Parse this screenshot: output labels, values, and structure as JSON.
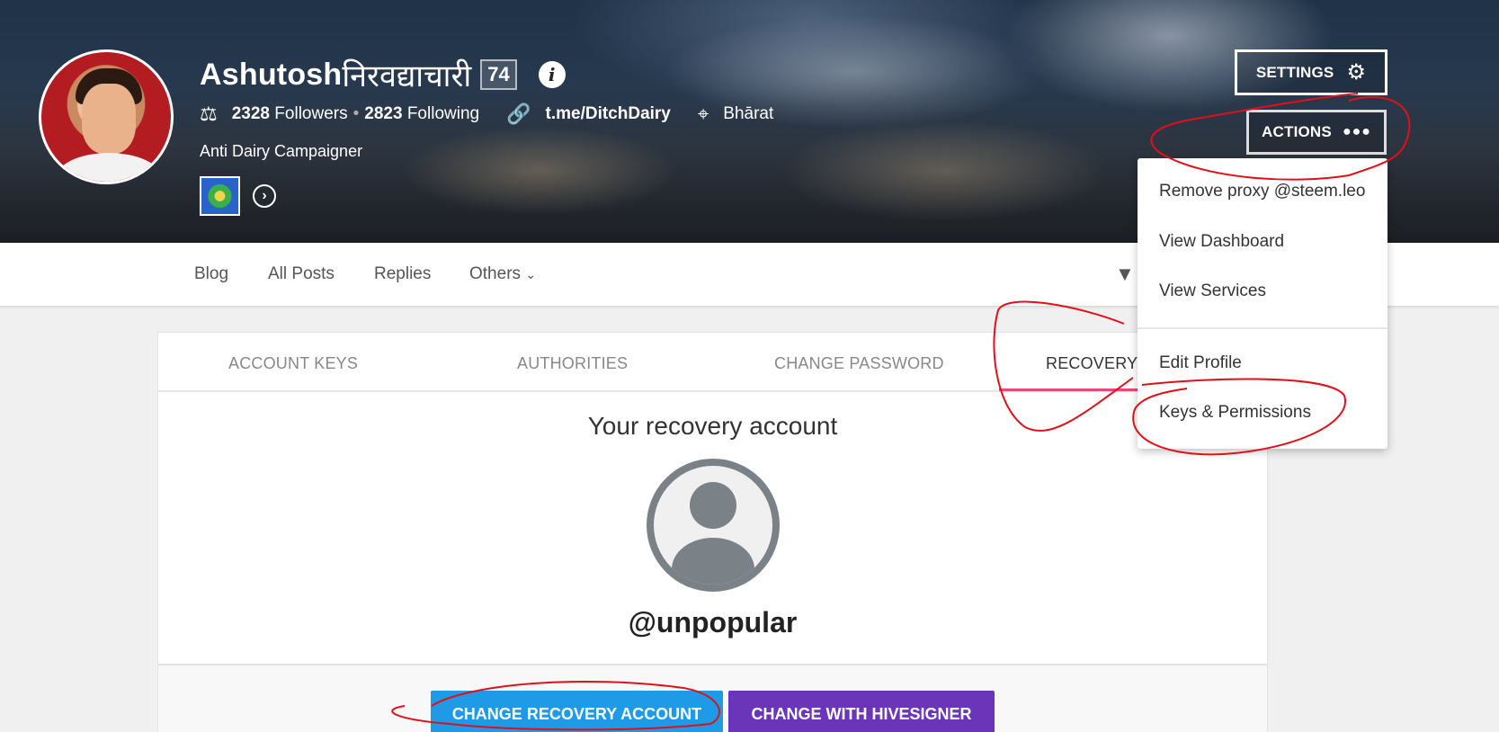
{
  "profile": {
    "name_latin": "Ashutosh",
    "name_devanagari": "निरवद्याचारी",
    "reputation": "74",
    "info_icon": "info-icon",
    "followers_count": "2328",
    "followers_label": "Followers",
    "following_count": "2823",
    "following_label": "Following",
    "website": "t.me/DitchDairy",
    "location": "Bhārat",
    "about": "Anti Dairy Campaigner"
  },
  "header_buttons": {
    "settings": "SETTINGS",
    "actions": "ACTIONS"
  },
  "nav": {
    "items": [
      "Blog",
      "All Posts",
      "Replies",
      "Others"
    ]
  },
  "dropdown": {
    "items": [
      "Remove proxy @steem.leo",
      "View Dashboard",
      "View Services",
      "Edit Profile",
      "Keys & Permissions"
    ]
  },
  "tabs": [
    "ACCOUNT KEYS",
    "AUTHORITIES",
    "CHANGE PASSWORD",
    "RECOVERY"
  ],
  "recovery": {
    "title": "Your recovery account",
    "account": "@unpopular",
    "change_button": "CHANGE RECOVERY ACCOUNT",
    "hive_button": "CHANGE WITH HIVESIGNER"
  },
  "colors": {
    "accent_tab": "#e64a7a",
    "change_button": "#1e9ae6",
    "hive_button": "#6a35b9",
    "annotation": "#e0101a"
  }
}
